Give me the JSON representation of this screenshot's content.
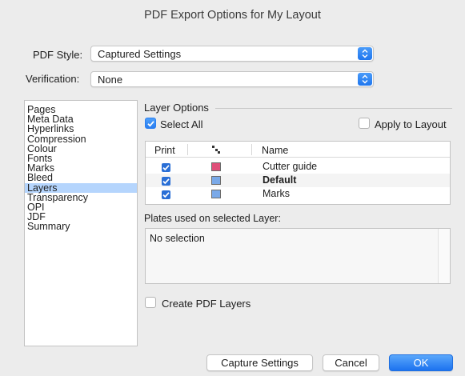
{
  "window": {
    "title": "PDF Export Options for My Layout"
  },
  "pdf_style": {
    "label": "PDF Style:",
    "value": "Captured Settings"
  },
  "verification": {
    "label": "Verification:",
    "value": "None"
  },
  "sidebar": {
    "items": [
      {
        "label": "Pages",
        "selected": false
      },
      {
        "label": "Meta Data",
        "selected": false
      },
      {
        "label": "Hyperlinks",
        "selected": false
      },
      {
        "label": "Compression",
        "selected": false
      },
      {
        "label": "Colour",
        "selected": false
      },
      {
        "label": "Fonts",
        "selected": false
      },
      {
        "label": "Marks",
        "selected": false
      },
      {
        "label": "Bleed",
        "selected": false
      },
      {
        "label": "Layers",
        "selected": true
      },
      {
        "label": "Transparency",
        "selected": false
      },
      {
        "label": "OPI",
        "selected": false
      },
      {
        "label": "JDF",
        "selected": false
      },
      {
        "label": "Summary",
        "selected": false
      }
    ]
  },
  "layer_options": {
    "title": "Layer Options",
    "select_all": {
      "label": "Select All",
      "checked": true
    },
    "apply_to_layout": {
      "label": "Apply to Layout",
      "checked": false
    },
    "table": {
      "headers": {
        "print": "Print",
        "name": "Name"
      },
      "rows": [
        {
          "print": true,
          "color": "#e0507a",
          "name": "Cutter guide",
          "bold": false
        },
        {
          "print": true,
          "color": "#7aa9e8",
          "name": "Default",
          "bold": true
        },
        {
          "print": true,
          "color": "#7aa9e8",
          "name": "Marks",
          "bold": false
        }
      ]
    },
    "plates_label": "Plates used on selected Layer:",
    "plates_text": "No selection",
    "create_pdf_layers": {
      "label": "Create PDF Layers",
      "checked": false
    }
  },
  "buttons": {
    "capture": "Capture Settings",
    "cancel": "Cancel",
    "ok": "OK"
  },
  "colors": {
    "accent": "#1f76ee",
    "selection": "#b5d5fd"
  }
}
